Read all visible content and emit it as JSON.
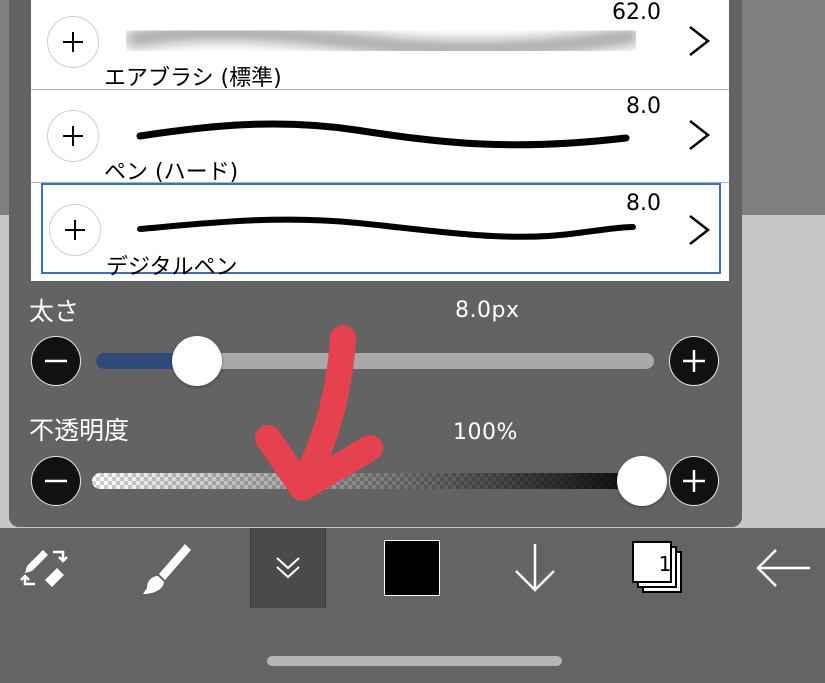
{
  "brushes": [
    {
      "name": "エアブラシ (標準)",
      "size": "62.0",
      "selected": false
    },
    {
      "name": "ペン (ハード)",
      "size": "8.0",
      "selected": false
    },
    {
      "name": "デジタルペン",
      "size": "8.0",
      "selected": true
    }
  ],
  "thickness": {
    "label": "太さ",
    "value": "8.0px",
    "level": 0.15
  },
  "opacity": {
    "label": "不透明度",
    "value": "100%",
    "level": 1.0
  },
  "toolbar": {
    "layer_count": "1"
  },
  "colors": {
    "panel": "#636363",
    "accent": "#3b6fb6",
    "track_fill": "#2f4a7a",
    "annotation_arrow": "#e5414f",
    "current_color": "#000000"
  },
  "icons": [
    "plus-icon",
    "chevron-right-icon",
    "minus-icon",
    "swap-tools-icon",
    "brush-icon",
    "double-chevron-down-icon",
    "color-swatch",
    "down-arrow-icon",
    "layers-icon",
    "back-arrow-icon"
  ]
}
